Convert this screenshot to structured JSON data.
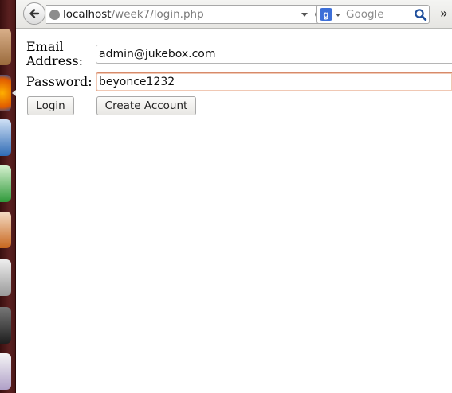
{
  "browser": {
    "url_host": "localhost",
    "url_path": "/week7/login.php",
    "search_engine_badge": "g",
    "search_placeholder": "Google",
    "overflow_chevron": "»"
  },
  "form": {
    "email_label_line1": "Email",
    "email_label_line2": "Address:",
    "email_value": "admin@jukebox.com",
    "password_label": "Password:",
    "password_value": "beyonce1232",
    "login_button": "Login",
    "create_account_button": "Create Account"
  },
  "launcher": {
    "tiles": [
      "files-icon",
      "firefox-icon",
      "writer-icon",
      "calc-icon",
      "impress-icon",
      "settings-icon",
      "terminal-icon",
      "editor-icon"
    ],
    "active_tile": "firefox-icon"
  },
  "colors": {
    "launcher_bg": "#5a2020",
    "focus_border": "#d78a6a",
    "google_blue": "#3d6fd8"
  }
}
